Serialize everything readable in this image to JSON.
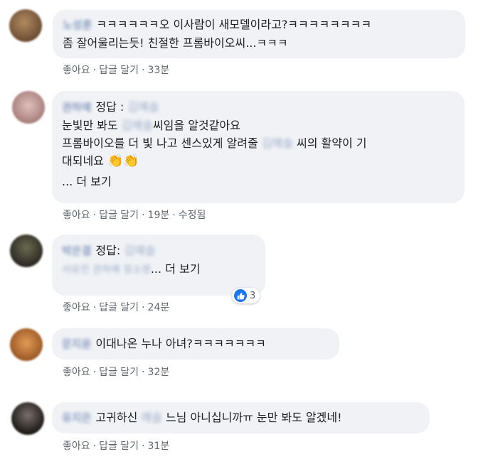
{
  "common": {
    "like_label": "좋아요",
    "reply_label": "답글 달기",
    "sep": "·",
    "more_label": "... 더 보기"
  },
  "comments": [
    {
      "author": "노성훈",
      "text_line1": "ㅋㅋㅋㅋㅋㅋ오 이사람이 새모델이라고?ㅋㅋㅋㅋㅋㅋㅋㅋ",
      "text_line2": "좀 잘어울리는듯! 친절한 프롬바이오씨...ㅋㅋㅋ",
      "time": "33분",
      "avatar_color": "#8a6a48"
    },
    {
      "author": "권하예",
      "answer_label": "정답 :",
      "answer_name": "김예슬",
      "line1_pre": "눈빛만 봐도",
      "line1_name": "김예슬",
      "line1_post": "씨임을 알것같아요",
      "line2_pre": "프롬바이오를 더 빛 나고 센스있게 알려줄",
      "line2_name": "김예슬",
      "line2_post": "씨의 활약이 기",
      "line3": "대되네요",
      "emoji": "👏👏",
      "time": "19분",
      "edited": "수정됨",
      "avatar_color": "#c9a3a1"
    },
    {
      "author": "박은결",
      "answer_label": "정답:",
      "answer_name": "김예슬",
      "line2_blur": "서유진 권하예 정소영",
      "time": "24분",
      "reaction_count": "3",
      "avatar_color": "#4e4a3e"
    },
    {
      "author": "문지윤",
      "text": "이대나온 누나 아녀?ㅋㅋㅋㅋㅋㅋㅋ",
      "time": "32분",
      "avatar_color": "#c07a3e"
    },
    {
      "author": "유지은",
      "text_pre": "고귀하신",
      "text_name": "예슬",
      "text_post": "느님 아니십니까ㅠ 눈만 봐도 알겠네!",
      "time": "31분",
      "avatar_color": "#3a3330"
    }
  ],
  "colors": {
    "bubble": "#f0f2f5",
    "link": "#385898",
    "meta": "#606770",
    "like_blue": "#1877f2"
  }
}
